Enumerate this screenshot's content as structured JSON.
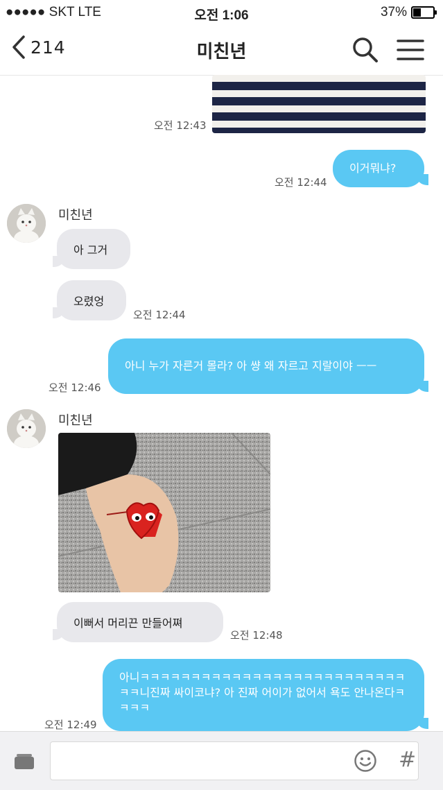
{
  "status_bar": {
    "carrier": "●●●●● SKT   LTE",
    "time": "오전 1:06",
    "battery": "37%",
    "battery_level": 0.37
  },
  "header": {
    "back_count": "214",
    "title": "미친년"
  },
  "messages": [
    {
      "type": "image_in",
      "time": "오전 12:43"
    },
    {
      "type": "text_out",
      "text": "이거뭐냐?",
      "time": "오전 12:44"
    },
    {
      "type": "sender",
      "name": "미친년"
    },
    {
      "type": "text_in",
      "text": "아 그거"
    },
    {
      "type": "text_in",
      "text": "오렸엉",
      "time": "오전 12:44"
    },
    {
      "type": "text_out",
      "text": "아니 누가 자른거 몰라? 아 썅 왜 자르고 지랄이야 ㅡㅡ",
      "time": "오전 12:46"
    },
    {
      "type": "sender",
      "name": "미친년"
    },
    {
      "type": "image_in"
    },
    {
      "type": "text_in",
      "text": "이뻐서 머리끈 만들어쪄",
      "time": "오전 12:48"
    },
    {
      "type": "text_out",
      "text": "아니ㅋㅋㅋㅋㅋㅋㅋㅋㅋㅋㅋㅋㅋㅋㅋㅋㅋㅋㅋㅋㅋㅋㅋㅋㅋㅋㅋㅋ니진짜 싸이코냐? 아 진짜 어이가 없어서 욕도 안나온다ㅋㅋㅋㅋ",
      "time": "오전 12:49"
    }
  ],
  "icons": {
    "back": "chevron-left-icon",
    "search": "search-icon",
    "menu": "menu-icon",
    "attach": "attach-icon",
    "emoji": "emoji-icon",
    "hashtag": "hashtag-icon"
  },
  "colors": {
    "outgoing_bubble": "#5ac8f3",
    "incoming_bubble": "#e8e8ec"
  },
  "bottom_bar": {
    "hashtag": "#"
  }
}
